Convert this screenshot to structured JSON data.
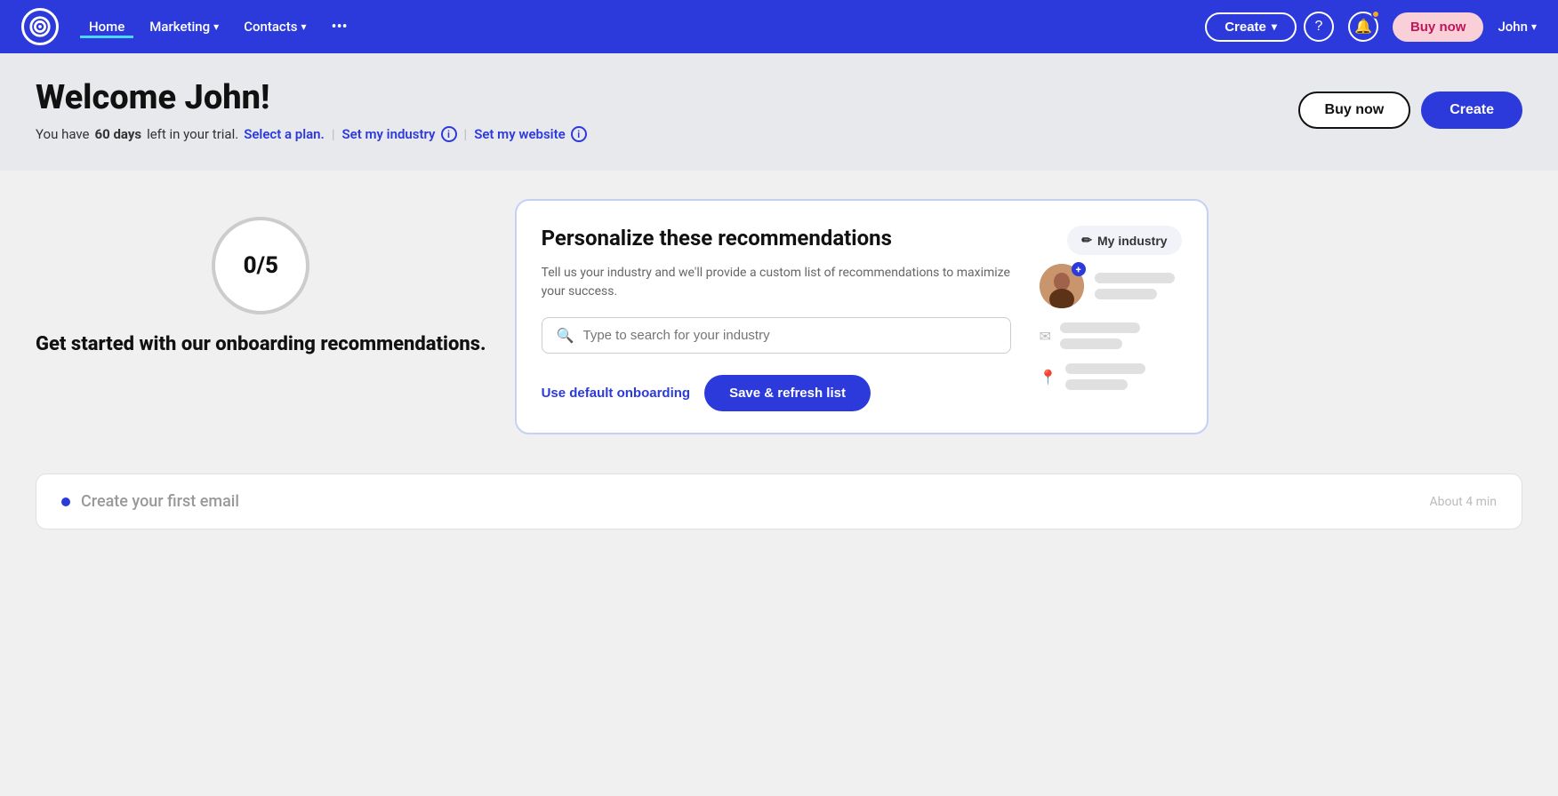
{
  "navbar": {
    "logo_alt": "Constant Contact logo",
    "links": [
      {
        "label": "Home",
        "active": true
      },
      {
        "label": "Marketing",
        "has_dropdown": true
      },
      {
        "label": "Contacts",
        "has_dropdown": true
      }
    ],
    "more_label": "•••",
    "create_btn": "Create",
    "help_icon": "?",
    "buy_now": "Buy now",
    "user": "John"
  },
  "hero": {
    "title": "Welcome John!",
    "trial_text": "You have ",
    "trial_days": "60 days",
    "trial_suffix": " left in your trial.",
    "select_plan": "Select a plan.",
    "set_industry": "Set my industry",
    "set_website": "Set my website",
    "buy_now": "Buy now",
    "create": "Create"
  },
  "progress": {
    "value": "0/5",
    "label": "Get started with our onboarding recommendations."
  },
  "panel": {
    "title": "Personalize these recommendations",
    "subtitle": "Tell us your industry and we'll provide a custom list of recommendations to maximize your success.",
    "search_placeholder": "Type to search for your industry",
    "my_industry_label": "My industry",
    "edit_icon": "✏",
    "default_onboarding": "Use default onboarding",
    "save_btn": "Save & refresh list"
  },
  "bottom_task": {
    "label": "Create your first email",
    "time": "About 4 min"
  }
}
